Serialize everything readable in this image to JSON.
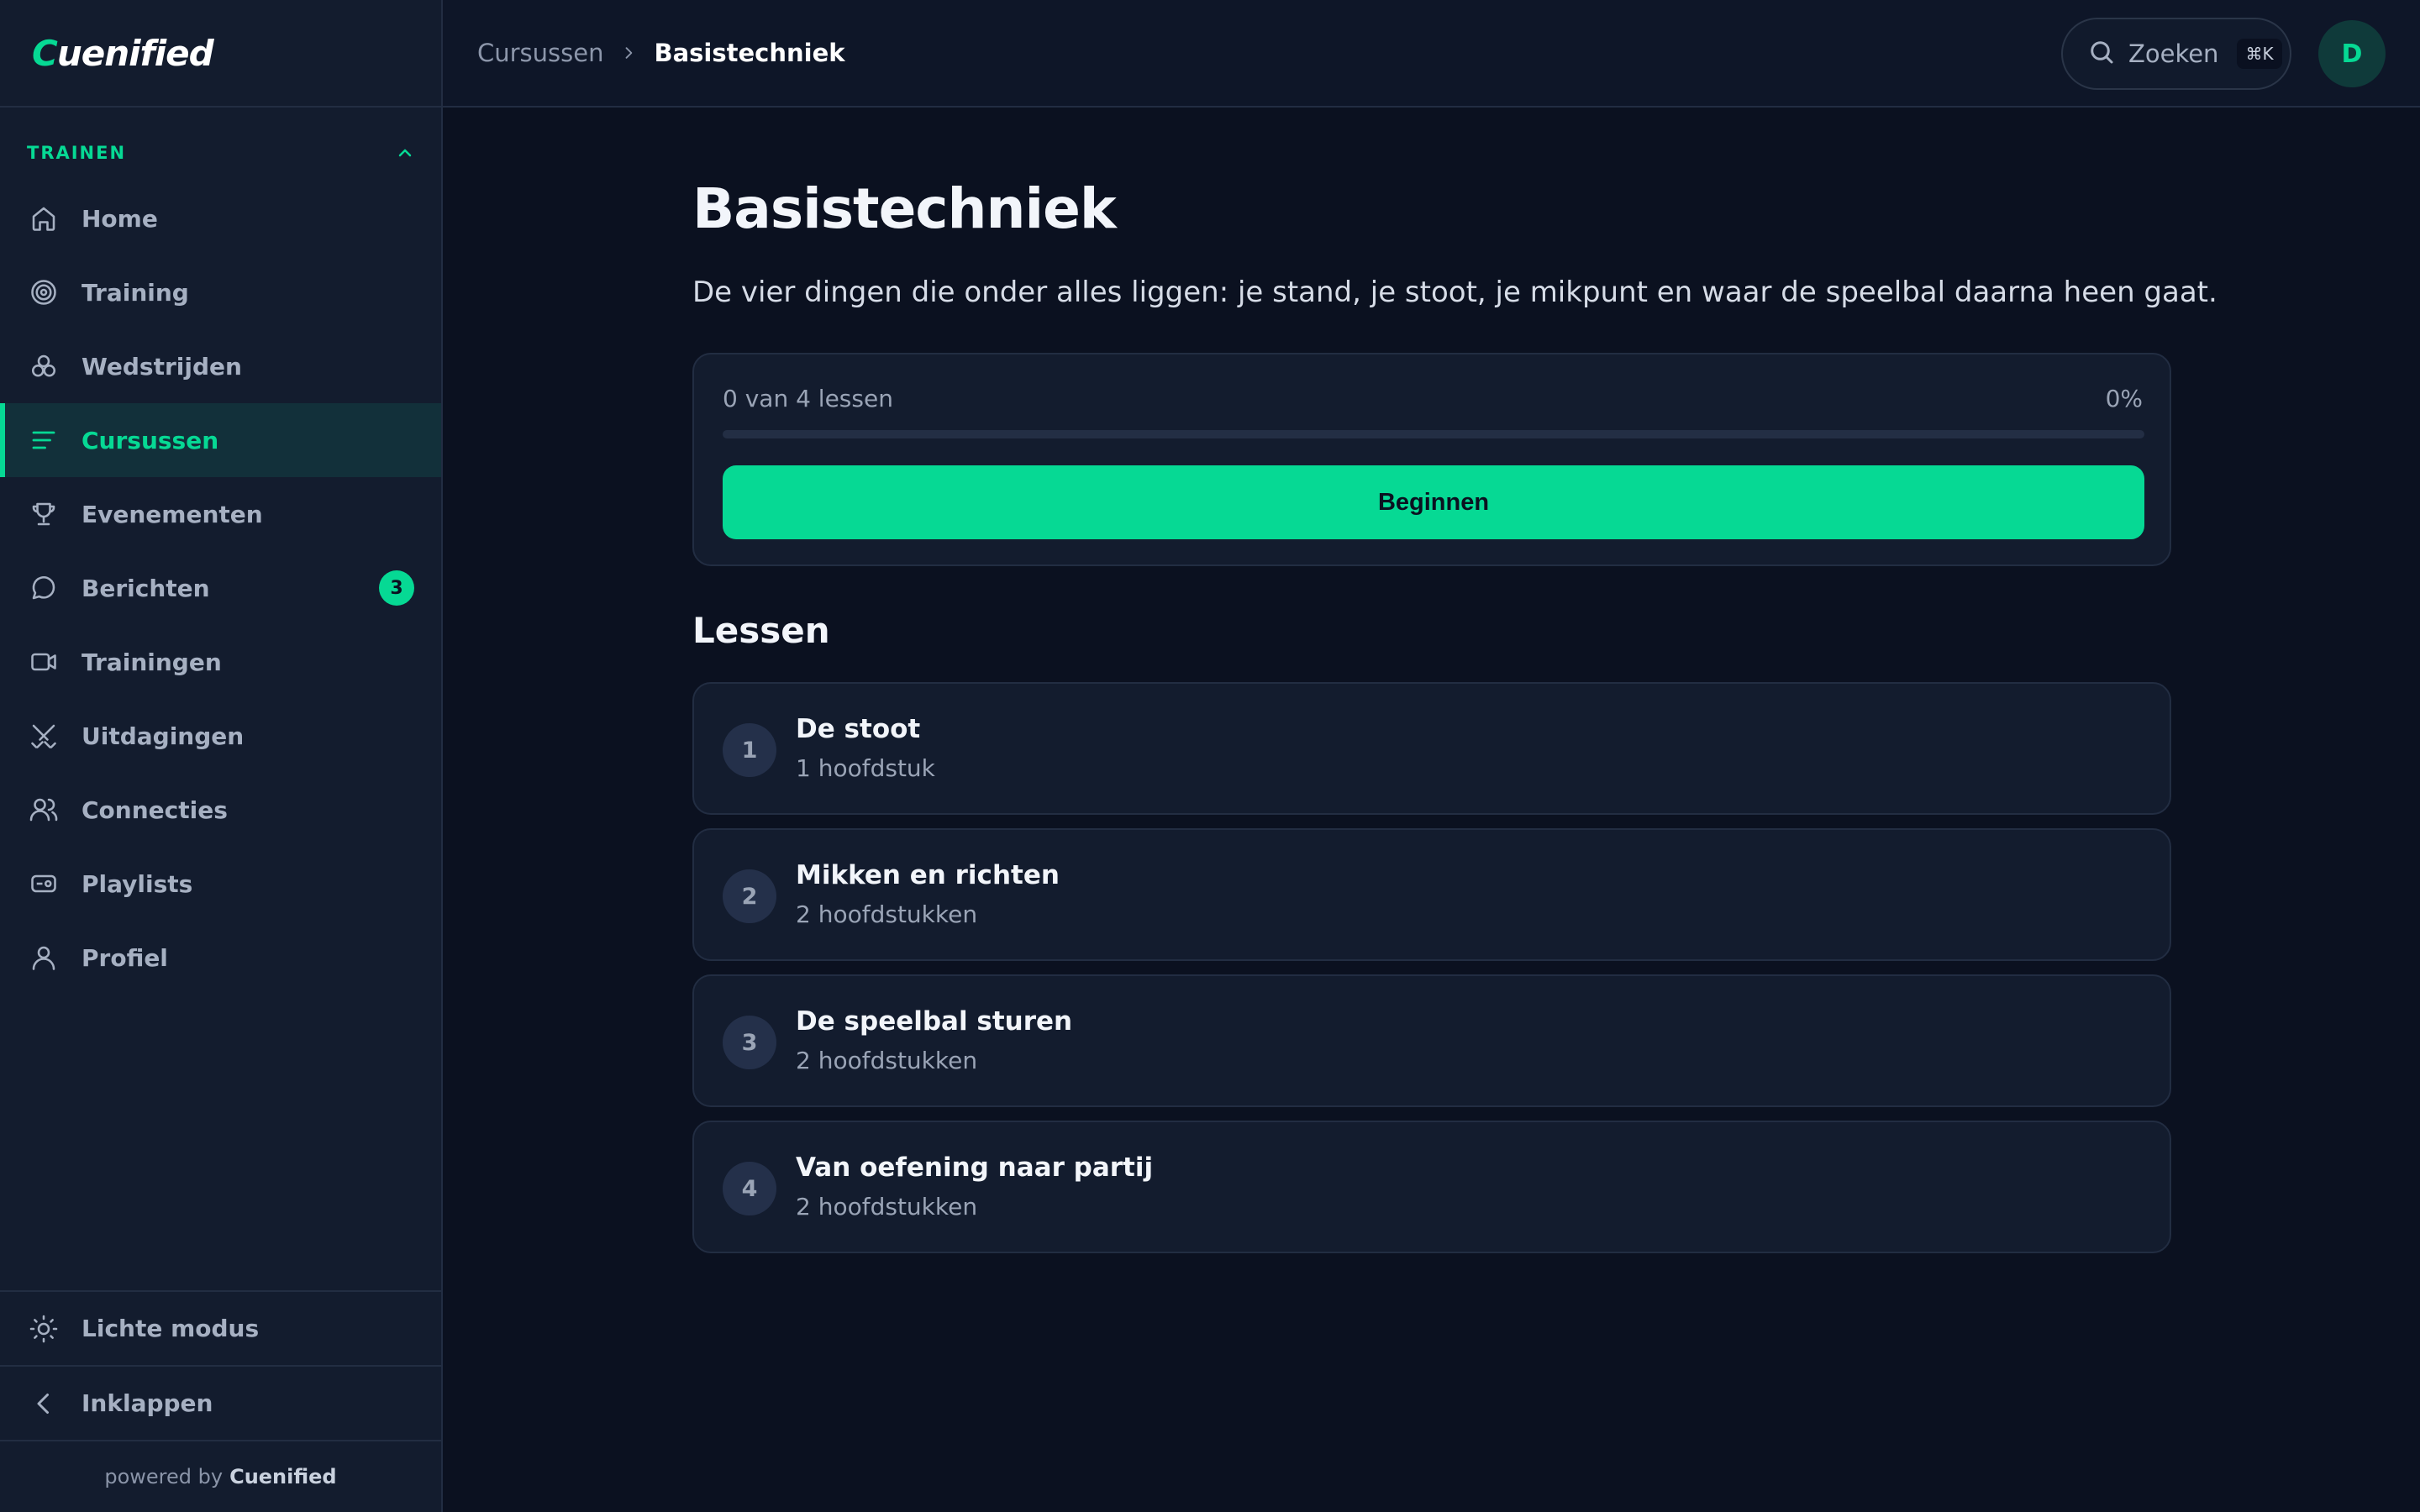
{
  "brand": {
    "logo_text_accent": "C",
    "logo_text": "uenified",
    "accent_color": "#06d994"
  },
  "sidebar": {
    "section_label": "TRAINEN",
    "items": [
      {
        "label": "Home",
        "icon": "home-icon"
      },
      {
        "label": "Training",
        "icon": "target-icon"
      },
      {
        "label": "Wedstrijden",
        "icon": "balls-icon"
      },
      {
        "label": "Cursussen",
        "icon": "list-icon",
        "active": true
      },
      {
        "label": "Evenementen",
        "icon": "trophy-icon"
      },
      {
        "label": "Berichten",
        "icon": "chat-icon",
        "badge": "3"
      },
      {
        "label": "Trainingen",
        "icon": "video-icon"
      },
      {
        "label": "Uitdagingen",
        "icon": "swords-icon"
      },
      {
        "label": "Connecties",
        "icon": "users-icon"
      },
      {
        "label": "Playlists",
        "icon": "playlist-icon"
      },
      {
        "label": "Profiel",
        "icon": "user-icon"
      }
    ],
    "theme_toggle": "Lichte modus",
    "collapse": "Inklappen",
    "powered_prefix": "powered by",
    "powered_brand": "Cuenified"
  },
  "header": {
    "breadcrumb": [
      "Cursussen",
      "Basistechniek"
    ],
    "search_label": "Zoeken",
    "search_shortcut": "⌘K",
    "avatar_initial": "D"
  },
  "course": {
    "title": "Basistechniek",
    "description": "De vier dingen die onder alles liggen: je stand, je stoot, je mikpunt en waar de speelbal daarna heen gaat.",
    "progress_text": "0 van 4 lessen",
    "progress_percent_label": "0%",
    "progress_fraction": 0,
    "start_button": "Beginnen",
    "lessons_heading": "Lessen",
    "lessons": [
      {
        "number": "1",
        "title": "De stoot",
        "subtitle": "1 hoofdstuk"
      },
      {
        "number": "2",
        "title": "Mikken en richten",
        "subtitle": "2 hoofdstukken"
      },
      {
        "number": "3",
        "title": "De speelbal sturen",
        "subtitle": "2 hoofdstukken"
      },
      {
        "number": "4",
        "title": "Van oefening naar partij",
        "subtitle": "2 hoofdstukken"
      }
    ]
  }
}
